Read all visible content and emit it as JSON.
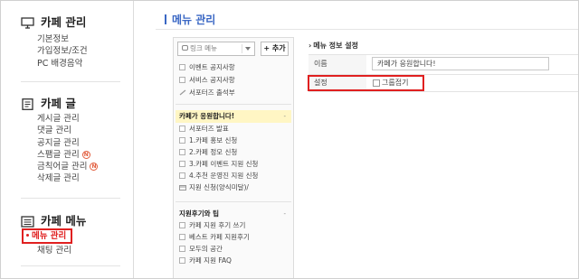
{
  "sidebar": {
    "cafe_admin": {
      "title": "카페 관리",
      "items": [
        "기본정보",
        "가입정보/조건",
        "PC 배경음악"
      ]
    },
    "posts": {
      "title": "카페 글",
      "items": [
        "게시글 관리",
        "댓글 관리",
        "공지글 관리",
        "스팸글 관리",
        "금칙어글 관리",
        "삭제글 관리"
      ],
      "new_badge": "N"
    },
    "cafe_menu": {
      "title": "카페 메뉴",
      "active_item": "메뉴 관리",
      "items": [
        "채팅 관리"
      ]
    }
  },
  "page": {
    "title": "메뉴 관리"
  },
  "menu_tree": {
    "link_select": "링크 메뉴",
    "add_button": "+ 추가",
    "top_items": [
      "이벤트 공지사항",
      "서비스 공지사항",
      "서포터즈 출석부"
    ],
    "group1": {
      "title": "카페가 응원합니다!",
      "toggle": "-",
      "items": [
        "서포터즈 발표",
        "1.카페 홍보 신청",
        "2.카페 정모 신청",
        "3.카페 이벤트 지원 신청",
        "4.추천 운영진 지원 신청",
        "지원 신청(양식미달)/"
      ]
    },
    "group2": {
      "title": "지원후기와 팁",
      "toggle": "-",
      "items": [
        "카페 지원 후기 쓰기",
        "베스트 카페 지원후기",
        "모두의 공간",
        "카페 지원 FAQ"
      ]
    }
  },
  "settings": {
    "section_title": "메뉴 정보 설정",
    "name_label": "이름",
    "name_value": "카페가 응원합니다!",
    "setting_label": "설정",
    "collapse_label": "그룹접기",
    "collapse_checked": false
  }
}
